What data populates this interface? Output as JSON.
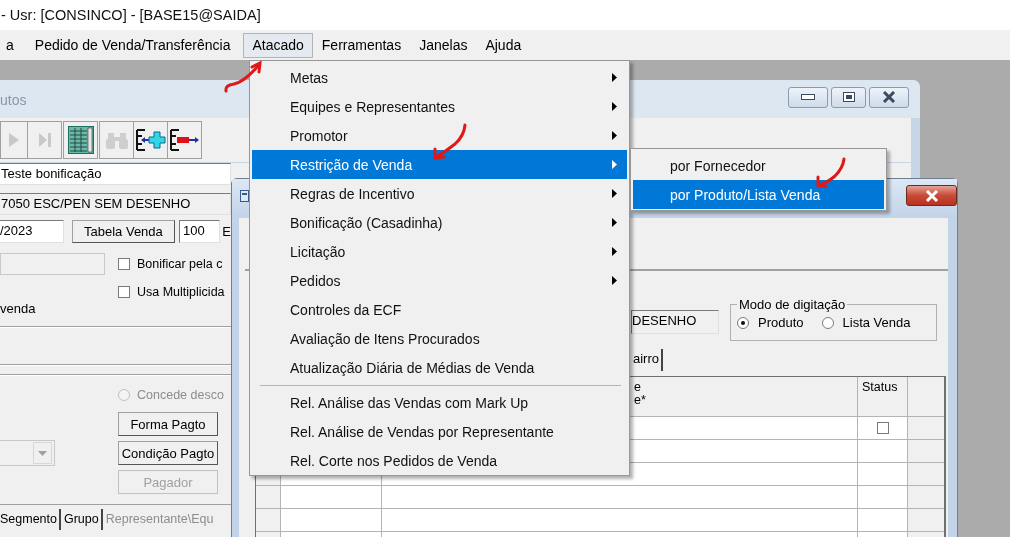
{
  "app_title": "- Usr: [CONSINCO] - [BASE15@SAIDA]",
  "menu_bar": [
    {
      "label": "a",
      "selected": false
    },
    {
      "label": "Pedido de Venda/Transferência",
      "selected": false
    },
    {
      "label": "Atacado",
      "selected": true
    },
    {
      "label": "Ferramentas",
      "selected": false
    },
    {
      "label": "Janelas",
      "selected": false
    },
    {
      "label": "Ajuda",
      "selected": false
    }
  ],
  "back_window": {
    "title": "utos",
    "toolbar": [
      {
        "kind": "next",
        "disabled": true
      },
      {
        "kind": "last",
        "disabled": true
      },
      {
        "kind": "grid",
        "disabled": false
      },
      {
        "kind": "find",
        "disabled": true
      },
      {
        "kind": "add",
        "disabled": false
      },
      {
        "kind": "remove",
        "disabled": false
      }
    ],
    "description": "Teste bonificação",
    "product": "7050 ESC/PEN SEM DESENHO",
    "date": "/2023",
    "price_table_button": "Tabela Venda",
    "quantity": "100",
    "cut_label": "E",
    "checkboxes": [
      {
        "label": "Bonificar pela c",
        "checked": false
      },
      {
        "label": "Usa Multiplicida",
        "checked": false
      }
    ],
    "note": "venda",
    "radio": {
      "label": "Concede desco",
      "selected": false,
      "disabled": true
    },
    "buttons": [
      {
        "label": "Forma Pagto",
        "disabled": false
      },
      {
        "label": "Condição Pagto",
        "disabled": false
      },
      {
        "label": "Pagador",
        "disabled": true
      }
    ],
    "tabs": [
      {
        "label": "Segmento",
        "disabled": false
      },
      {
        "label": "Grupo",
        "disabled": false
      },
      {
        "label": "Representante\\Equ",
        "disabled": true
      }
    ]
  },
  "front_window": {
    "product": "DESENHO",
    "mode_group": {
      "label": "Modo de digitação",
      "options": [
        {
          "label": "Produto",
          "selected": true
        },
        {
          "label": "Lista Venda",
          "selected": false
        }
      ]
    },
    "tab": "airro",
    "grid": {
      "columns": [
        {
          "lines": [
            "e",
            "e*"
          ]
        },
        {
          "lines": [
            "Status"
          ]
        }
      ],
      "rows": [
        {
          "checked": false
        }
      ]
    }
  },
  "menu": {
    "items": [
      {
        "label": "Metas",
        "kind": "submenu",
        "selected": false
      },
      {
        "label": "Equipes e Representantes",
        "kind": "submenu",
        "selected": false
      },
      {
        "label": "Promotor",
        "kind": "submenu",
        "selected": false
      },
      {
        "label": "Restrição de Venda",
        "kind": "submenu",
        "selected": true
      },
      {
        "label": "Regras de Incentivo",
        "kind": "submenu",
        "selected": false
      },
      {
        "label": "Bonificação (Casadinha)",
        "kind": "submenu",
        "selected": false
      },
      {
        "label": "Licitação",
        "kind": "submenu",
        "selected": false
      },
      {
        "label": "Pedidos",
        "kind": "submenu",
        "selected": false
      },
      {
        "label": "Controles da ECF",
        "kind": "item",
        "selected": false
      },
      {
        "label": "Avaliação de Itens Procurados",
        "kind": "item",
        "selected": false
      },
      {
        "label": "Atualização Diária de Médias de Venda",
        "kind": "item",
        "selected": false
      },
      {
        "kind": "separator"
      },
      {
        "label": "Rel. Análise das Vendas com Mark Up",
        "kind": "item",
        "selected": false
      },
      {
        "label": "Rel. Análise de Vendas por Representante",
        "kind": "item",
        "selected": false
      },
      {
        "label": "Rel. Corte nos Pedidos de Venda",
        "kind": "item",
        "selected": false
      }
    ]
  },
  "submenu": {
    "items": [
      {
        "label": "por Fornecedor",
        "selected": false
      },
      {
        "label": "por Produto/Lista Venda",
        "selected": true
      }
    ]
  }
}
